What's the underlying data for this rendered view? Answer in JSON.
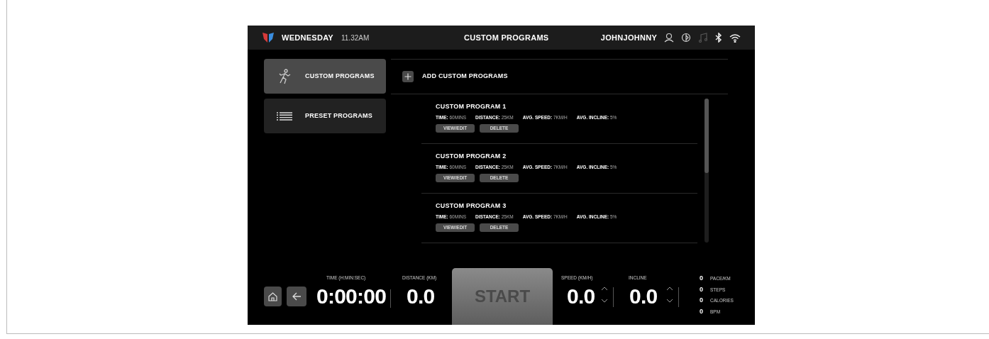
{
  "top_bar": {
    "day": "WEDNESDAY",
    "time": "11.32AM",
    "title": "CUSTOM PROGRAMS",
    "user": "JOHNJOHNNY"
  },
  "sidebar": {
    "items": [
      {
        "label": "CUSTOM PROGRAMS",
        "selected": true
      },
      {
        "label": "PRESET PROGRAMS",
        "selected": false
      }
    ]
  },
  "add_button": {
    "label": "ADD CUSTOM PROGRAMS"
  },
  "programs": [
    {
      "name": "CUSTOM PROGRAM 1",
      "stats": [
        {
          "label": "TIME:",
          "value": "60MINS"
        },
        {
          "label": "DISTANCE:",
          "value": "25KM"
        },
        {
          "label": "AVG. SPEED:",
          "value": "7KM/H"
        },
        {
          "label": "AVG. INCLINE:",
          "value": "5%"
        }
      ],
      "buttons": [
        "VIEW/EDIT",
        "DELETE"
      ]
    },
    {
      "name": "CUSTOM PROGRAM 2",
      "stats": [
        {
          "label": "TIME:",
          "value": "60MINS"
        },
        {
          "label": "DISTANCE:",
          "value": "25KM"
        },
        {
          "label": "AVG. SPEED:",
          "value": "7KM/H"
        },
        {
          "label": "AVG. INCLINE:",
          "value": "5%"
        }
      ],
      "buttons": [
        "VIEW/EDIT",
        "DELETE"
      ]
    },
    {
      "name": "CUSTOM PROGRAM 3",
      "stats": [
        {
          "label": "TIME:",
          "value": "60MINS"
        },
        {
          "label": "DISTANCE:",
          "value": "25KM"
        },
        {
          "label": "AVG. SPEED:",
          "value": "7KM/H"
        },
        {
          "label": "AVG. INCLINE:",
          "value": "5%"
        }
      ],
      "buttons": [
        "VIEW/EDIT",
        "DELETE"
      ]
    }
  ],
  "bottom_bar": {
    "time": {
      "label": "TIME (H:MIN:SEC)",
      "value": "0:00:00"
    },
    "distance": {
      "label": "DISTANCE (KM)",
      "value": "0.0"
    },
    "start": "START",
    "speed": {
      "label": "SPEED (KM/H)",
      "value": "0.0"
    },
    "incline": {
      "label": "INCLINE",
      "value": "0.0"
    },
    "metrics": [
      {
        "value": "0",
        "label": "PACE/KM"
      },
      {
        "value": "0",
        "label": "STEPS"
      },
      {
        "value": "0",
        "label": "CALORIES"
      },
      {
        "value": "0",
        "label": "BPM"
      }
    ]
  }
}
